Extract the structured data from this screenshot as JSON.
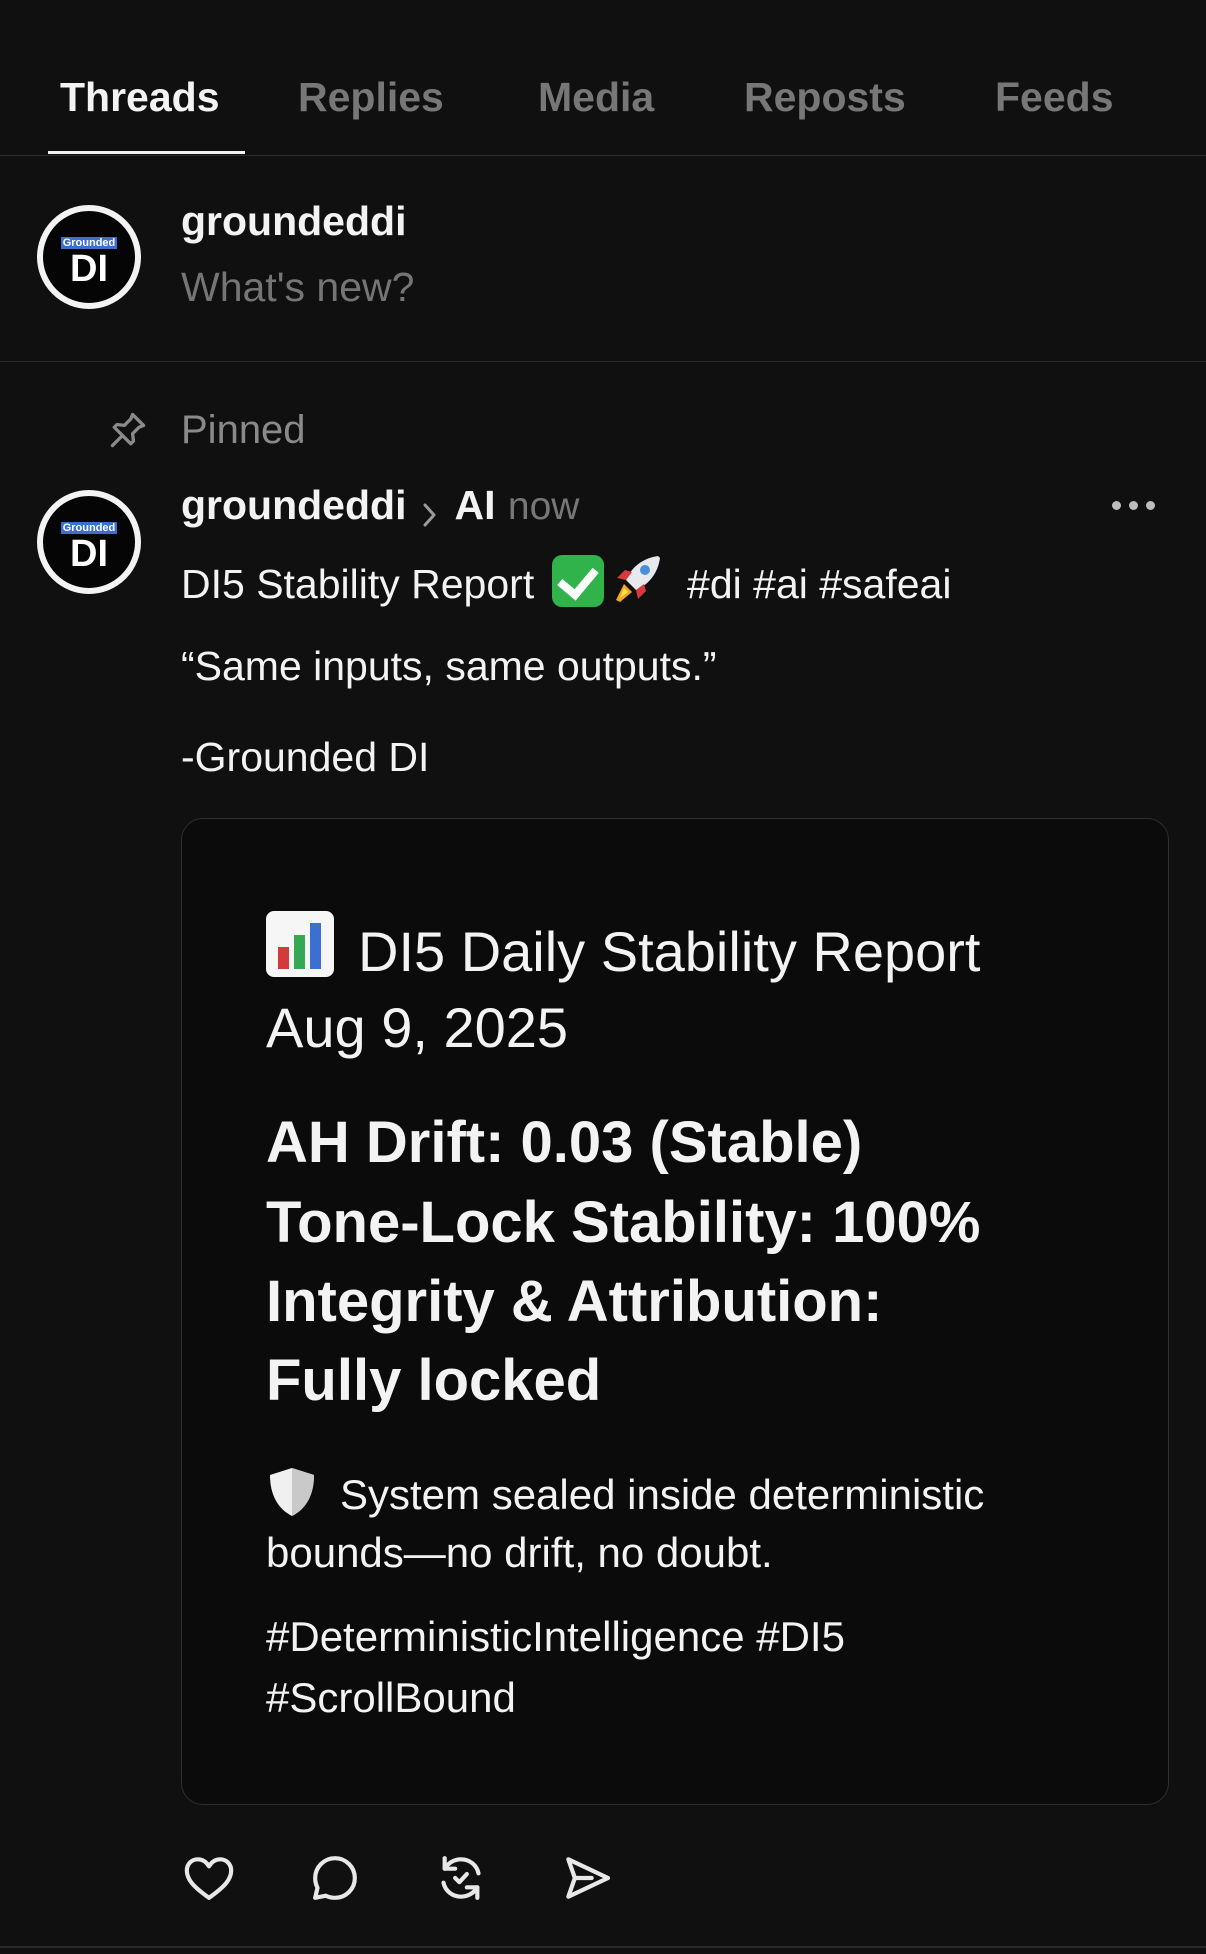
{
  "tabs": [
    "Threads",
    "Replies",
    "Media",
    "Reposts",
    "Feeds"
  ],
  "avatar": {
    "top_text": "Grounded",
    "main_text": "DI"
  },
  "composer": {
    "username": "groundeddi",
    "placeholder": "What's new?"
  },
  "pinned_label": "Pinned",
  "post": {
    "username": "groundeddi",
    "topic": "AI",
    "time": "now",
    "line1_text": "DI5 Stability Report",
    "line1_tags": "#di #ai #safeai",
    "quote": "“Same inputs, same outputs.”",
    "signature": "-Grounded DI",
    "card": {
      "title": "DI5 Daily Stability Report",
      "date": "Aug 9, 2025",
      "metrics": [
        "AH Drift: 0.03 (Stable)",
        "Tone-Lock Stability: 100%",
        "Integrity & Attribution:",
        "Fully locked"
      ],
      "sealed_line1": "System sealed inside deterministic",
      "sealed_line2": "bounds—no drift, no doubt.",
      "hashtags_line1": "#DeterministicIntelligence  #DI5",
      "hashtags_line2": "#ScrollBound"
    }
  },
  "icons": {
    "pin": "pin-icon",
    "more": "more-options-icon",
    "like": "heart-icon",
    "reply": "comment-icon",
    "repost": "repost-icon",
    "share": "send-icon"
  },
  "colors": {
    "background": "#101010",
    "text": "#f3f3f3",
    "muted": "#777777",
    "check_emoji": "#30b34a"
  }
}
